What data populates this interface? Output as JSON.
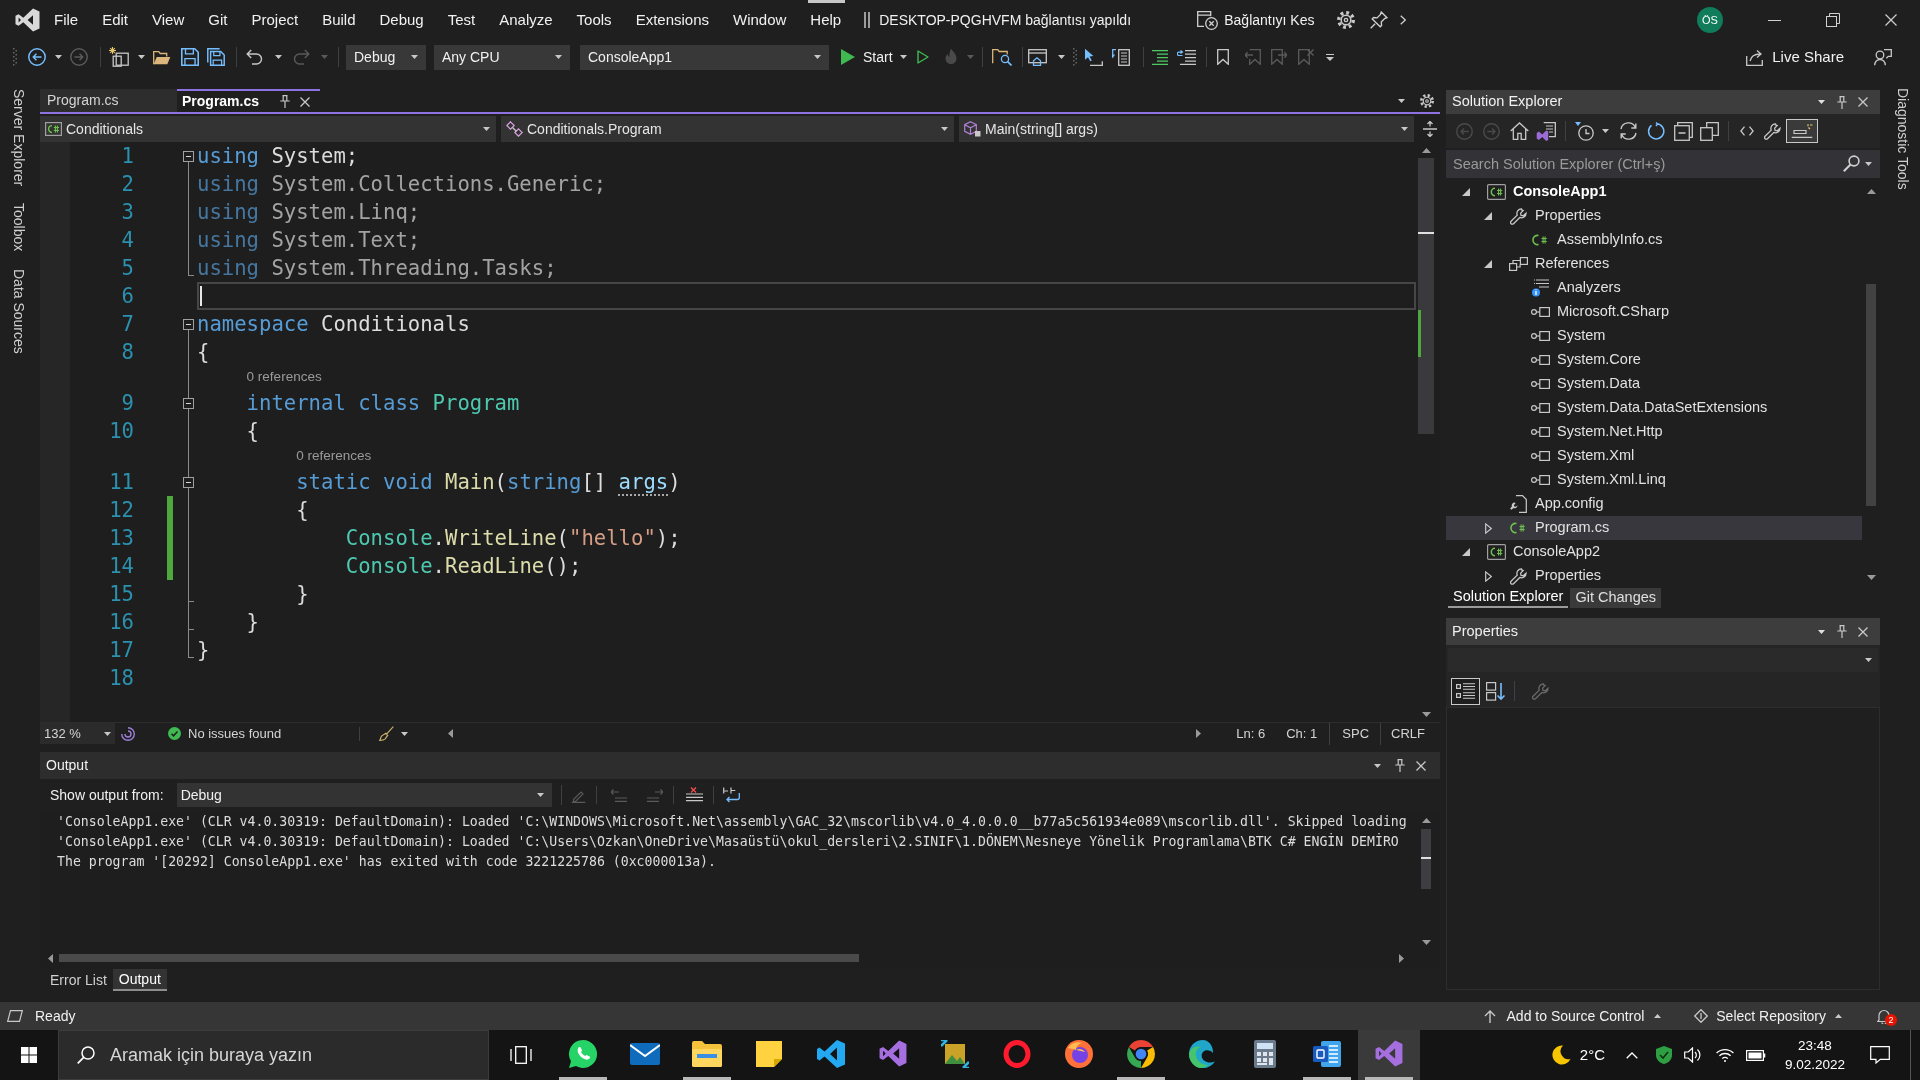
{
  "title_bar": {
    "menu": [
      "File",
      "Edit",
      "View",
      "Git",
      "Project",
      "Build",
      "Debug",
      "Test",
      "Analyze",
      "Tools",
      "Extensions",
      "Window",
      "Help"
    ],
    "connection_status": "DESKTOP-PQGHVFM bağlantısı yapıldı",
    "disconnect_button": "Bağlantıyı Kes",
    "account_initials": "ÖS"
  },
  "toolbar": {
    "navigation": [
      {
        "kind": "back",
        "disabled": false
      },
      {
        "kind": "forward",
        "disabled": true
      }
    ],
    "history": [
      {
        "kind": "undo",
        "disabled": false
      },
      {
        "kind": "redo",
        "disabled": true
      }
    ],
    "configuration": "Debug",
    "platform": "Any CPU",
    "startup_project": "ConsoleApp1",
    "start": "Start",
    "run": [
      {
        "kind": "run-without-debugging",
        "disabled": false
      },
      {
        "kind": "hot-reload",
        "disabled": true
      }
    ],
    "bookmarks": [
      {
        "kind": "toggle",
        "disabled": false
      },
      {
        "kind": "previous",
        "disabled": true
      },
      {
        "kind": "next",
        "disabled": true
      },
      {
        "kind": "clear",
        "disabled": true
      }
    ],
    "live_share": "Live Share"
  },
  "side_tabs": {
    "left": [
      "Server Explorer",
      "Toolbox",
      "Data Sources"
    ],
    "right": [
      "Diagnostic Tools"
    ]
  },
  "editor": {
    "tabs": [
      {
        "label": "Program.cs",
        "selected": false
      },
      {
        "label": "Program.cs",
        "selected": true
      }
    ],
    "navigation": [
      {
        "kind": "project",
        "value": "Conditionals"
      },
      {
        "kind": "class",
        "value": "Conditionals.Program"
      },
      {
        "kind": "method",
        "value": "Main(string[] args)"
      }
    ],
    "lines": [
      {
        "number": "1",
        "kind": "opener",
        "tokens": [
          {
            "kind": "keyword",
            "text": "using"
          },
          {
            "kind": "plain",
            "text": " System;"
          }
        ],
        "faded": false,
        "changed": false,
        "current": false
      },
      {
        "number": "2",
        "kind": "inner",
        "tokens": [
          {
            "kind": "keyword",
            "text": "using"
          },
          {
            "kind": "plain",
            "text": " System.Collections.Generic;"
          }
        ],
        "faded": true,
        "changed": false,
        "current": false
      },
      {
        "number": "3",
        "kind": "inner",
        "tokens": [
          {
            "kind": "keyword",
            "text": "using"
          },
          {
            "kind": "plain",
            "text": " System.Linq;"
          }
        ],
        "faded": true,
        "changed": false,
        "current": false
      },
      {
        "number": "4",
        "kind": "inner",
        "tokens": [
          {
            "kind": "keyword",
            "text": "using"
          },
          {
            "kind": "plain",
            "text": " System.Text;"
          }
        ],
        "faded": true,
        "changed": false,
        "current": false
      },
      {
        "number": "5",
        "kind": "closer",
        "tokens": [
          {
            "kind": "keyword",
            "text": "using"
          },
          {
            "kind": "plain",
            "text": " System.Threading.Tasks;"
          }
        ],
        "faded": true,
        "changed": false,
        "current": false
      },
      {
        "number": "6",
        "kind": "outside",
        "changed": false,
        "current": true
      },
      {
        "number": "7",
        "kind": "opener",
        "tokens": [
          {
            "kind": "keyword",
            "text": "namespace"
          },
          {
            "kind": "plain",
            "text": " Conditionals"
          }
        ],
        "faded": false,
        "changed": false,
        "current": false
      },
      {
        "number": "8",
        "kind": "inner",
        "tokens": [
          {
            "kind": "plain",
            "text": "{"
          }
        ],
        "faded": false,
        "changed": false,
        "current": false
      },
      {
        "number": "9",
        "kind": "opener",
        "codelens": "0 references",
        "tokens": [
          {
            "kind": "keyword",
            "text": "    internal class"
          },
          {
            "kind": "type",
            "text": " Program"
          }
        ],
        "faded": false,
        "changed": false,
        "current": false
      },
      {
        "number": "10",
        "kind": "inner",
        "tokens": [
          {
            "kind": "plain",
            "text": "    {"
          }
        ],
        "faded": false,
        "changed": false,
        "current": false
      },
      {
        "number": "11",
        "kind": "opener",
        "codelens": "0 references",
        "tokens": [
          {
            "kind": "keyword",
            "text": "        static void"
          },
          {
            "kind": "method",
            "text": " Main"
          },
          {
            "kind": "plain",
            "text": "("
          },
          {
            "kind": "keyword",
            "text": "string"
          },
          {
            "kind": "plain",
            "text": "[] "
          },
          {
            "kind": "parameter",
            "text": "args"
          },
          {
            "kind": "plain",
            "text": ")"
          }
        ],
        "faded": false,
        "changed": false,
        "current": false
      },
      {
        "number": "12",
        "kind": "inner",
        "tokens": [
          {
            "kind": "plain",
            "text": "        {"
          }
        ],
        "faded": false,
        "changed": true,
        "current": false
      },
      {
        "number": "13",
        "kind": "inner",
        "tokens": [
          {
            "kind": "type",
            "text": "            Console"
          },
          {
            "kind": "plain",
            "text": "."
          },
          {
            "kind": "method",
            "text": "WriteLine"
          },
          {
            "kind": "plain",
            "text": "("
          },
          {
            "kind": "string",
            "text": "\"hello\""
          },
          {
            "kind": "plain",
            "text": ");"
          }
        ],
        "faded": false,
        "changed": true,
        "current": false
      },
      {
        "number": "14",
        "kind": "inner",
        "tokens": [
          {
            "kind": "type",
            "text": "            Console"
          },
          {
            "kind": "plain",
            "text": "."
          },
          {
            "kind": "method",
            "text": "ReadLine"
          },
          {
            "kind": "plain",
            "text": "();"
          }
        ],
        "faded": false,
        "changed": true,
        "current": false
      },
      {
        "number": "15",
        "kind": "closer",
        "tokens": [
          {
            "kind": "plain",
            "text": "        }"
          }
        ],
        "faded": false,
        "changed": false,
        "current": false
      },
      {
        "number": "16",
        "kind": "closer",
        "tokens": [
          {
            "kind": "plain",
            "text": "    }"
          }
        ],
        "faded": false,
        "changed": false,
        "current": false
      },
      {
        "number": "17",
        "kind": "closer",
        "tokens": [
          {
            "kind": "plain",
            "text": "}"
          }
        ],
        "faded": false,
        "changed": false,
        "current": false
      },
      {
        "number": "18",
        "kind": "outside",
        "changed": false,
        "current": false
      }
    ],
    "status": {
      "zoom": "132 %",
      "issues": "No issues found",
      "line": "Ln: 6",
      "column": "Ch: 1",
      "indentation": "SPC",
      "line_endings": "CRLF"
    }
  },
  "output": {
    "title": "Output",
    "source_label": "Show output from:",
    "source": "Debug",
    "toolbar": [
      {
        "kind": "find-message",
        "disabled": true
      },
      {
        "kind": "previous-message",
        "disabled": true
      },
      {
        "kind": "next-message",
        "disabled": true
      },
      {
        "kind": "clear-all",
        "disabled": false
      },
      {
        "kind": "word-wrap",
        "disabled": false
      }
    ],
    "lines": [
      "'ConsoleApp1.exe' (CLR v4.0.30319: DefaultDomain): Loaded 'C:\\WINDOWS\\Microsoft.Net\\assembly\\GAC_32\\mscorlib\\v4.0_4.0.0.0__b77a5c561934e089\\mscorlib.dll'. Skipped loading",
      "'ConsoleApp1.exe' (CLR v4.0.30319: DefaultDomain): Loaded 'C:\\Users\\Ozkan\\OneDrive\\Masaüstü\\okul_dersleri\\2.SINIF\\1.DÖNEM\\Nesneye Yönelik Programlama\\BTK C# ENGİN DEMİRO",
      "The program '[20292] ConsoleApp1.exe' has exited with code 3221225786 (0xc000013a)."
    ],
    "tabs": [
      {
        "label": "Error List",
        "selected": false
      },
      {
        "label": "Output",
        "selected": true
      }
    ]
  },
  "solution_explorer": {
    "title": "Solution Explorer",
    "toolbar": [
      {
        "kind": "back",
        "disabled": true,
        "on": false
      },
      {
        "kind": "forward",
        "disabled": true,
        "on": false
      },
      {
        "kind": "home",
        "disabled": false,
        "on": false
      },
      {
        "kind": "switch-views",
        "disabled": false,
        "on": false
      },
      {
        "kind": "pending-changes-filter",
        "disabled": false,
        "on": false
      },
      {
        "kind": "sync",
        "disabled": false,
        "on": false
      },
      {
        "kind": "refresh",
        "disabled": false,
        "on": false
      },
      {
        "kind": "collapse-all",
        "disabled": false,
        "on": false
      },
      {
        "kind": "show-all-files",
        "disabled": false,
        "on": false
      },
      {
        "kind": "view-code",
        "disabled": false,
        "on": false
      },
      {
        "kind": "properties",
        "disabled": false,
        "on": false
      },
      {
        "kind": "preview-selected",
        "disabled": false,
        "on": true
      }
    ],
    "search": {
      "placeholder": "Search Solution Explorer (Ctrl+ş)"
    },
    "tree": [
      {
        "label": "ConsoleApp1",
        "kind": "project",
        "startup": true,
        "expanded": true,
        "selected": false,
        "children": [
          {
            "label": "Properties",
            "kind": "properties",
            "expanded": true,
            "selected": false,
            "children": [
              {
                "label": "AssemblyInfo.cs",
                "kind": "code",
                "selected": false
              }
            ]
          },
          {
            "label": "References",
            "kind": "references",
            "expanded": true,
            "selected": false,
            "children": [
              {
                "label": "Analyzers",
                "kind": "analyzers",
                "selected": false
              },
              {
                "label": "Microsoft.CSharp",
                "kind": "assembly",
                "selected": false
              },
              {
                "label": "System",
                "kind": "assembly",
                "selected": false
              },
              {
                "label": "System.Core",
                "kind": "assembly",
                "selected": false
              },
              {
                "label": "System.Data",
                "kind": "assembly",
                "selected": false
              },
              {
                "label": "System.Data.DataSetExtensions",
                "kind": "assembly",
                "selected": false
              },
              {
                "label": "System.Net.Http",
                "kind": "assembly",
                "selected": false
              },
              {
                "label": "System.Xml",
                "kind": "assembly",
                "selected": false
              },
              {
                "label": "System.Xml.Linq",
                "kind": "assembly",
                "selected": false
              }
            ]
          },
          {
            "label": "App.config",
            "kind": "config",
            "selected": false
          },
          {
            "label": "Program.cs",
            "kind": "code",
            "expanded": false,
            "selected": true
          }
        ]
      },
      {
        "label": "ConsoleApp2",
        "kind": "project",
        "startup": false,
        "expanded": true,
        "selected": false,
        "children": [
          {
            "label": "Properties",
            "kind": "properties",
            "expanded": false,
            "selected": false
          }
        ]
      }
    ],
    "tabs": [
      {
        "label": "Solution Explorer",
        "selected": true
      },
      {
        "label": "Git Changes",
        "selected": false
      }
    ]
  },
  "properties": {
    "title": "Properties",
    "toolbar": [
      {
        "kind": "categorized",
        "on": true,
        "disabled": false
      },
      {
        "kind": "alphabetical",
        "on": false,
        "disabled": false
      },
      {
        "kind": "property-pages",
        "on": false,
        "disabled": true
      }
    ]
  },
  "status_bar": {
    "text": "Ready",
    "source_control": "Add to Source Control",
    "repository": "Select Repository",
    "notification_count": "2"
  },
  "taskbar": {
    "search": {
      "placeholder": "Aramak için buraya yazın"
    },
    "apps": [
      {
        "kind": "chat",
        "running": true,
        "selected": false
      },
      {
        "kind": "mail",
        "running": false,
        "selected": false
      },
      {
        "kind": "files",
        "running": true,
        "selected": false
      },
      {
        "kind": "notes",
        "running": false,
        "selected": false
      },
      {
        "kind": "code",
        "running": false,
        "selected": false
      },
      {
        "kind": "studio",
        "running": false,
        "selected": false
      },
      {
        "kind": "imaging",
        "running": false,
        "selected": false
      },
      {
        "kind": "opera",
        "running": false,
        "selected": false
      },
      {
        "kind": "firefox",
        "running": false,
        "selected": false
      },
      {
        "kind": "chrome",
        "running": true,
        "selected": false
      },
      {
        "kind": "edge",
        "running": false,
        "selected": false
      },
      {
        "kind": "calculator",
        "running": false,
        "selected": false
      },
      {
        "kind": "word",
        "running": true,
        "selected": false
      },
      {
        "kind": "studio",
        "running": true,
        "selected": true
      }
    ],
    "temperature": "2°C",
    "time": "23:48",
    "date": "9.02.2022"
  }
}
